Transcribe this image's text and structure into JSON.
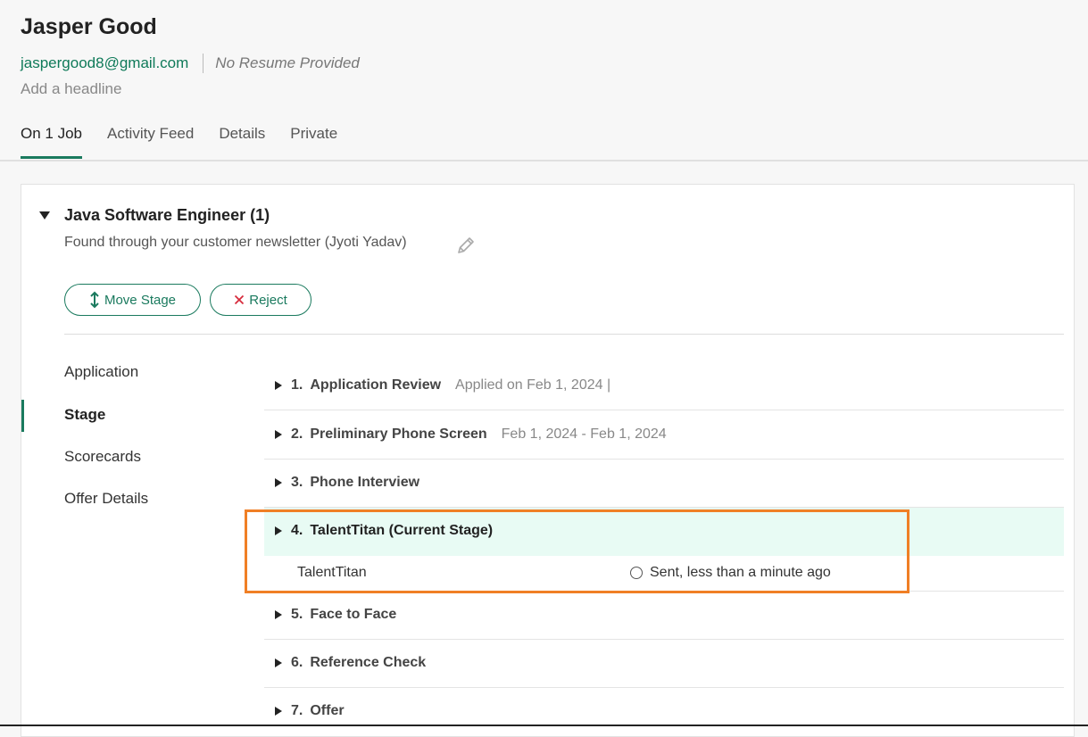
{
  "candidate": {
    "name": "Jasper Good",
    "email": "jaspergood8@gmail.com",
    "resume_status": "No Resume Provided",
    "headline_placeholder": "Add a headline"
  },
  "tabs": [
    {
      "label": "On 1 Job",
      "active": true
    },
    {
      "label": "Activity Feed",
      "active": false
    },
    {
      "label": "Details",
      "active": false
    },
    {
      "label": "Private",
      "active": false
    }
  ],
  "job": {
    "title": "Java Software Engineer (1)",
    "source": "Found through your customer newsletter (Jyoti Yadav)",
    "buttons": {
      "move_stage": "Move Stage",
      "reject": "Reject"
    }
  },
  "side_nav": [
    {
      "label": "Application",
      "active": false
    },
    {
      "label": "Stage",
      "active": true
    },
    {
      "label": "Scorecards",
      "active": false
    },
    {
      "label": "Offer Details",
      "active": false
    }
  ],
  "stages": [
    {
      "number": "1.",
      "name": "Application Review",
      "detail": "Applied on Feb 1, 2024 |"
    },
    {
      "number": "2.",
      "name": "Preliminary Phone Screen",
      "detail": "Feb 1, 2024 - Feb 1, 2024"
    },
    {
      "number": "3.",
      "name": "Phone Interview",
      "detail": ""
    },
    {
      "number": "4.",
      "name": "TalentTitan (Current Stage)",
      "detail": "",
      "current": true,
      "sub": {
        "label": "TalentTitan",
        "status": "Sent, less than a minute ago"
      }
    },
    {
      "number": "5.",
      "name": "Face to Face",
      "detail": ""
    },
    {
      "number": "6.",
      "name": "Reference Check",
      "detail": ""
    },
    {
      "number": "7.",
      "name": "Offer",
      "detail": ""
    }
  ],
  "colors": {
    "accent": "#1a7a5e",
    "current_stage_bg": "#e8fbf4",
    "highlight_border": "#f07f25",
    "reject_icon": "#d62b3c"
  }
}
